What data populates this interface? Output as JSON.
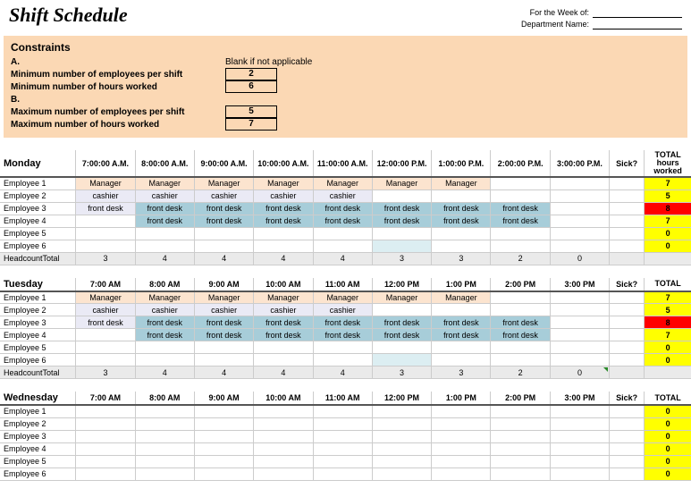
{
  "title": "Shift Schedule",
  "meta": {
    "for_week": "For the Week of:",
    "dept": "Department Name:"
  },
  "constraints": {
    "heading": "Constraints",
    "a": "A.",
    "note": "Blank if not applicable",
    "min_emp_label": "Minimum number of employees per shift",
    "min_emp_val": "2",
    "min_hrs_label": "Minimum number of hours worked",
    "min_hrs_val": "6",
    "b": "B.",
    "max_emp_label": "Maximum number of employees per shift",
    "max_emp_val": "5",
    "max_hrs_label": "Maximum number of hours worked",
    "max_hrs_val": "7"
  },
  "labels": {
    "sick": "Sick?",
    "total_long": "TOTAL hours worked",
    "total_short": "TOTAL",
    "headcount": "HeadcountTotal",
    "emp": [
      "Employee 1",
      "Employee 2",
      "Employee 3",
      "Employee 4",
      "Employee 5",
      "Employee 6"
    ]
  },
  "monday": {
    "name": "Monday",
    "times": [
      "7:00:00 A.M.",
      "8:00:00 A.M.",
      "9:00:00 A.M.",
      "10:00:00 A.M.",
      "11:00:00 A.M.",
      "12:00:00 P.M.",
      "1:00:00 P.M.",
      "2:00:00 P.M.",
      "3:00:00 P.M."
    ],
    "rows": [
      {
        "cells": [
          "Manager",
          "Manager",
          "Manager",
          "Manager",
          "Manager",
          "Manager",
          "Manager",
          "",
          ""
        ],
        "styles": [
          "m",
          "m",
          "m",
          "m",
          "m",
          "m",
          "m",
          "",
          ""
        ],
        "total": "7",
        "tclass": "y"
      },
      {
        "cells": [
          "cashier",
          "cashier",
          "cashier",
          "cashier",
          "cashier",
          "",
          "",
          "",
          ""
        ],
        "styles": [
          "c",
          "c",
          "c",
          "c",
          "c",
          "",
          "",
          "",
          ""
        ],
        "total": "5",
        "tclass": "y"
      },
      {
        "cells": [
          "front desk",
          "front desk",
          "front desk",
          "front desk",
          "front desk",
          "front desk",
          "front desk",
          "front desk",
          ""
        ],
        "styles": [
          "c",
          "f",
          "f",
          "f",
          "f",
          "f",
          "f",
          "f",
          ""
        ],
        "total": "8",
        "tclass": "r"
      },
      {
        "cells": [
          "",
          "front desk",
          "front desk",
          "front desk",
          "front desk",
          "front desk",
          "front desk",
          "front desk",
          ""
        ],
        "styles": [
          "",
          "f",
          "f",
          "f",
          "f",
          "f",
          "f",
          "f",
          ""
        ],
        "total": "7",
        "tclass": "y"
      },
      {
        "cells": [
          "",
          "",
          "",
          "",
          "",
          "",
          "",
          "",
          ""
        ],
        "styles": [
          "",
          "",
          "",
          "",
          "",
          "",
          "",
          "",
          ""
        ],
        "total": "0",
        "tclass": "y"
      },
      {
        "cells": [
          "",
          "",
          "",
          "",
          "",
          "",
          "",
          "",
          ""
        ],
        "styles": [
          "",
          "",
          "",
          "",
          "",
          "flt",
          "",
          "",
          ""
        ],
        "total": "0",
        "tclass": "y"
      }
    ],
    "headcount": [
      "3",
      "4",
      "4",
      "4",
      "4",
      "3",
      "3",
      "2",
      "0"
    ],
    "hcstyles": [
      "",
      "",
      "",
      "",
      "",
      "",
      "",
      "",
      "hr"
    ]
  },
  "tuesday": {
    "name": "Tuesday",
    "times": [
      "7:00 AM",
      "8:00 AM",
      "9:00 AM",
      "10:00 AM",
      "11:00 AM",
      "12:00 PM",
      "1:00 PM",
      "2:00 PM",
      "3:00 PM"
    ],
    "rows": [
      {
        "cells": [
          "Manager",
          "Manager",
          "Manager",
          "Manager",
          "Manager",
          "Manager",
          "Manager",
          "",
          ""
        ],
        "styles": [
          "m",
          "m",
          "m",
          "m",
          "m",
          "m",
          "m",
          "",
          ""
        ],
        "total": "7",
        "tclass": "y"
      },
      {
        "cells": [
          "cashier",
          "cashier",
          "cashier",
          "cashier",
          "cashier",
          "",
          "",
          "",
          ""
        ],
        "styles": [
          "c",
          "c",
          "c",
          "c",
          "c",
          "",
          "",
          "",
          ""
        ],
        "total": "5",
        "tclass": "y"
      },
      {
        "cells": [
          "front desk",
          "front desk",
          "front desk",
          "front desk",
          "front desk",
          "front desk",
          "front desk",
          "front desk",
          ""
        ],
        "styles": [
          "c",
          "f",
          "f",
          "f",
          "f",
          "f",
          "f",
          "f",
          ""
        ],
        "total": "8",
        "tclass": "r"
      },
      {
        "cells": [
          "",
          "front desk",
          "front desk",
          "front desk",
          "front desk",
          "front desk",
          "front desk",
          "front desk",
          ""
        ],
        "styles": [
          "",
          "f",
          "f",
          "f",
          "f",
          "f",
          "f",
          "f",
          ""
        ],
        "total": "7",
        "tclass": "y"
      },
      {
        "cells": [
          "",
          "",
          "",
          "",
          "",
          "",
          "",
          "",
          ""
        ],
        "styles": [
          "",
          "",
          "",
          "",
          "",
          "",
          "",
          "",
          ""
        ],
        "total": "0",
        "tclass": "y"
      },
      {
        "cells": [
          "",
          "",
          "",
          "",
          "",
          "",
          "",
          "",
          ""
        ],
        "styles": [
          "",
          "",
          "",
          "",
          "",
          "flt",
          "",
          "",
          ""
        ],
        "total": "0",
        "tclass": "y"
      }
    ],
    "headcount": [
      "3",
      "4",
      "4",
      "4",
      "4",
      "3",
      "3",
      "2",
      "0"
    ],
    "hcstyles": [
      "",
      "",
      "",
      "",
      "",
      "",
      "",
      "",
      "tri"
    ]
  },
  "wednesday": {
    "name": "Wednesday",
    "times": [
      "7:00 AM",
      "8:00 AM",
      "9:00 AM",
      "10:00 AM",
      "11:00 AM",
      "12:00 PM",
      "1:00 PM",
      "2:00 PM",
      "3:00 PM"
    ],
    "rows": [
      {
        "cells": [
          "",
          "",
          "",
          "",
          "",
          "",
          "",
          "",
          ""
        ],
        "styles": [
          "",
          "",
          "",
          "",
          "",
          "",
          "",
          "",
          ""
        ],
        "total": "0",
        "tclass": "y"
      },
      {
        "cells": [
          "",
          "",
          "",
          "",
          "",
          "",
          "",
          "",
          ""
        ],
        "styles": [
          "",
          "",
          "",
          "",
          "",
          "",
          "",
          "",
          ""
        ],
        "total": "0",
        "tclass": "y"
      },
      {
        "cells": [
          "",
          "",
          "",
          "",
          "",
          "",
          "",
          "",
          ""
        ],
        "styles": [
          "",
          "",
          "",
          "",
          "",
          "",
          "",
          "",
          ""
        ],
        "total": "0",
        "tclass": "y"
      },
      {
        "cells": [
          "",
          "",
          "",
          "",
          "",
          "",
          "",
          "",
          ""
        ],
        "styles": [
          "",
          "",
          "",
          "",
          "",
          "",
          "",
          "",
          ""
        ],
        "total": "0",
        "tclass": "y"
      },
      {
        "cells": [
          "",
          "",
          "",
          "",
          "",
          "",
          "",
          "",
          ""
        ],
        "styles": [
          "",
          "",
          "",
          "",
          "",
          "",
          "",
          "",
          ""
        ],
        "total": "0",
        "tclass": "y"
      },
      {
        "cells": [
          "",
          "",
          "",
          "",
          "",
          "",
          "",
          "",
          ""
        ],
        "styles": [
          "",
          "",
          "",
          "",
          "",
          "",
          "",
          "",
          ""
        ],
        "total": "0",
        "tclass": "y"
      }
    ]
  }
}
